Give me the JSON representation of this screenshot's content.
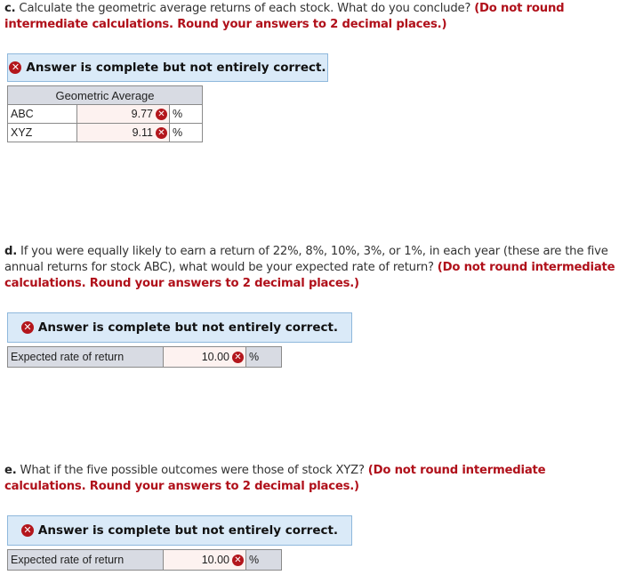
{
  "part_c": {
    "label": "c.",
    "question": " Calculate the geometric average returns of each stock. What do you conclude? ",
    "instruction": "(Do not round intermediate calculations. Round your answers to 2 decimal places.)",
    "banner": "Answer is complete but not entirely correct.",
    "table": {
      "header": "Geometric Average",
      "rows": [
        {
          "label": "ABC",
          "value": "9.77",
          "unit": "%",
          "status": "incorrect"
        },
        {
          "label": "XYZ",
          "value": "9.11",
          "unit": "%",
          "status": "incorrect"
        }
      ]
    }
  },
  "part_d": {
    "label": "d.",
    "question": " If you were equally likely to earn a return of 22%, 8%, 10%, 3%, or 1%, in each year (these are the five annual returns for stock ABC), what would be your expected rate of return? ",
    "instruction": "(Do not round intermediate calculations. Round your answers to 2 decimal places.)",
    "banner": "Answer is complete but not entirely correct.",
    "row": {
      "label": "Expected rate of return",
      "value": "10.00",
      "unit": "%",
      "status": "incorrect"
    }
  },
  "part_e": {
    "label": "e.",
    "question": " What if the five possible outcomes were those of stock XYZ? ",
    "instruction": "(Do not round intermediate calculations. Round your answers to 2 decimal places.)",
    "banner": "Answer is complete but not entirely correct.",
    "row": {
      "label": "Expected rate of return",
      "value": "10.00",
      "unit": "%",
      "status": "incorrect"
    }
  },
  "icons": {
    "incorrect": "✕"
  }
}
